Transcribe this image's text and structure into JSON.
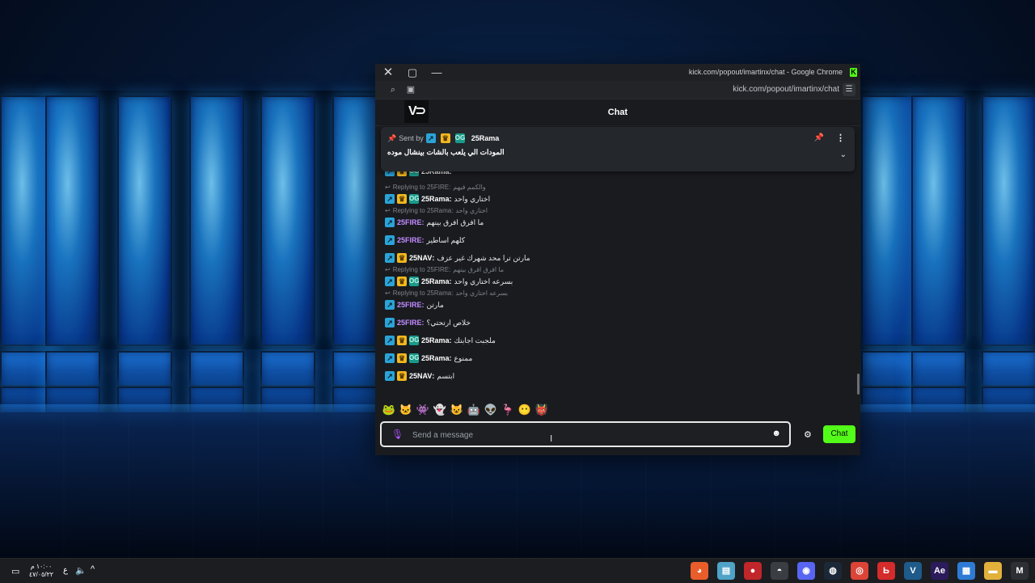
{
  "window": {
    "title": "kick.com/popout/imartinx/chat - Google Chrome",
    "url": "kick.com/popout/imartinx/chat",
    "close_icon": "close-icon",
    "maximize_icon": "maximize-icon",
    "minimize_icon": "minimize-icon",
    "logo": "V⊃"
  },
  "chat": {
    "header_title": "Chat",
    "pinned": {
      "sent_by": "Sent by",
      "username": "25Rama",
      "text": "المودات الي يلعب بالشات بينشال موده"
    },
    "partial_top": "25Rama:",
    "messages": [
      {
        "type": "reply",
        "text": "Replying to 25FIRE:",
        "quote": "والكمم فيهم"
      },
      {
        "type": "msg",
        "badges": [
          "arrow",
          "crown",
          "og"
        ],
        "user": "25Rama",
        "color": "u-rama",
        "text": "اختاري واحد"
      },
      {
        "type": "reply",
        "text": "Replying to 25Rama:",
        "quote": "اختاري واحد"
      },
      {
        "type": "msg",
        "badges": [
          "arrow"
        ],
        "user": "25FIRE",
        "color": "u-fire",
        "text": "ما افرق افرق بينهم"
      },
      {
        "type": "msg",
        "badges": [
          "arrow"
        ],
        "user": "25FIRE",
        "color": "u-fire",
        "text": "كلهم اساطير"
      },
      {
        "type": "msg",
        "badges": [
          "arrow",
          "crown"
        ],
        "user": "25NAV",
        "color": "u-nav",
        "text": "مارتن ترا محد شهرك غير عزف"
      },
      {
        "type": "reply",
        "text": "Replying to 25FIRE:",
        "quote": "ما افرق افرق بينهم"
      },
      {
        "type": "msg",
        "badges": [
          "arrow",
          "crown",
          "og"
        ],
        "user": "25Rama",
        "color": "u-rama",
        "text": "بسرعه اختاري واحد"
      },
      {
        "type": "reply",
        "text": "Replying to 25Rama:",
        "quote": "بسرعه اختاري واحد"
      },
      {
        "type": "msg",
        "badges": [
          "arrow"
        ],
        "user": "25FIRE",
        "color": "u-fire",
        "text": "مارتن"
      },
      {
        "type": "msg",
        "badges": [
          "arrow"
        ],
        "user": "25FIRE",
        "color": "u-fire",
        "text": "خلاص ارتحتي؟"
      },
      {
        "type": "msg",
        "badges": [
          "arrow",
          "crown",
          "og"
        ],
        "user": "25Rama",
        "color": "u-rama",
        "text": "ملجبت اجابتك"
      },
      {
        "type": "msg",
        "badges": [
          "arrow",
          "crown",
          "og"
        ],
        "user": "25Rama",
        "color": "u-rama",
        "text": "ممنوع"
      },
      {
        "type": "msg",
        "badges": [
          "arrow",
          "crown"
        ],
        "user": "25NAV",
        "color": "u-nav",
        "text": "ابتسم"
      }
    ],
    "emotes": [
      "🐸",
      "🐱",
      "👾",
      "👻",
      "😺",
      "🤖",
      "👽",
      "🦩",
      "😶",
      "👹"
    ],
    "input_placeholder": "Send a message",
    "send_label": "Chat"
  },
  "taskbar": {
    "clock_time": "١٠:٠٠ م",
    "clock_date": "٤٧/٠٥/٢٢",
    "lang": "ع",
    "apps": [
      {
        "name": "photos-app-icon",
        "glyph": "◕",
        "bg": "#e85d2a"
      },
      {
        "name": "notes-app-icon",
        "glyph": "▤",
        "bg": "#4fa3c7"
      },
      {
        "name": "game-app-icon",
        "glyph": "●",
        "bg": "#c0262a"
      },
      {
        "name": "ghost-app-icon",
        "glyph": "◓",
        "bg": "#3a3d42"
      },
      {
        "name": "discord-app-icon",
        "glyph": "◉",
        "bg": "#5865f2"
      },
      {
        "name": "steam-app-icon",
        "glyph": "◍",
        "bg": "#1b2838"
      },
      {
        "name": "chrome-app-icon",
        "glyph": "◎",
        "bg": "#db4437"
      },
      {
        "name": "red-app-icon",
        "glyph": "Ь",
        "bg": "#d42b2b"
      },
      {
        "name": "vegas-app-icon",
        "glyph": "V",
        "bg": "#1e5a8a"
      },
      {
        "name": "after-effects-app-icon",
        "glyph": "Ae",
        "bg": "#2b1b5a"
      },
      {
        "name": "store-app-icon",
        "glyph": "▦",
        "bg": "#2e7bd6"
      },
      {
        "name": "folder-app-icon",
        "glyph": "▬",
        "bg": "#e2b13c"
      },
      {
        "name": "mail-app-icon",
        "glyph": "M",
        "bg": "#2c2f34"
      }
    ]
  }
}
